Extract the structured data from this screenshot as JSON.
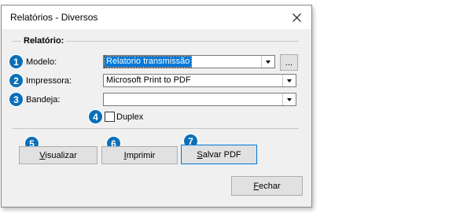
{
  "window": {
    "title": "Relatórios - Diversos"
  },
  "group": {
    "title": "Relatório:"
  },
  "fields": {
    "modelo": {
      "label": "Modelo:",
      "value": "Relatorio transmissão",
      "browse": "..."
    },
    "impressora": {
      "label": "Impressora:",
      "value": "Microsoft Print to PDF"
    },
    "bandeja": {
      "label": "Bandeja:",
      "value": ""
    },
    "duplex": {
      "label": "Duplex",
      "checked": false
    }
  },
  "buttons": {
    "visualizar": {
      "first": "V",
      "rest": "isualizar"
    },
    "imprimir": {
      "first": "I",
      "rest": "mprimir"
    },
    "salvar_pdf": {
      "first": "S",
      "rest": "alvar PDF"
    },
    "fechar": {
      "first": "F",
      "rest": "echar"
    }
  },
  "badges": [
    "1",
    "2",
    "3",
    "4",
    "5",
    "6",
    "7"
  ],
  "colors": {
    "badge": "#0b6fb8",
    "selection": "#0078d7"
  }
}
